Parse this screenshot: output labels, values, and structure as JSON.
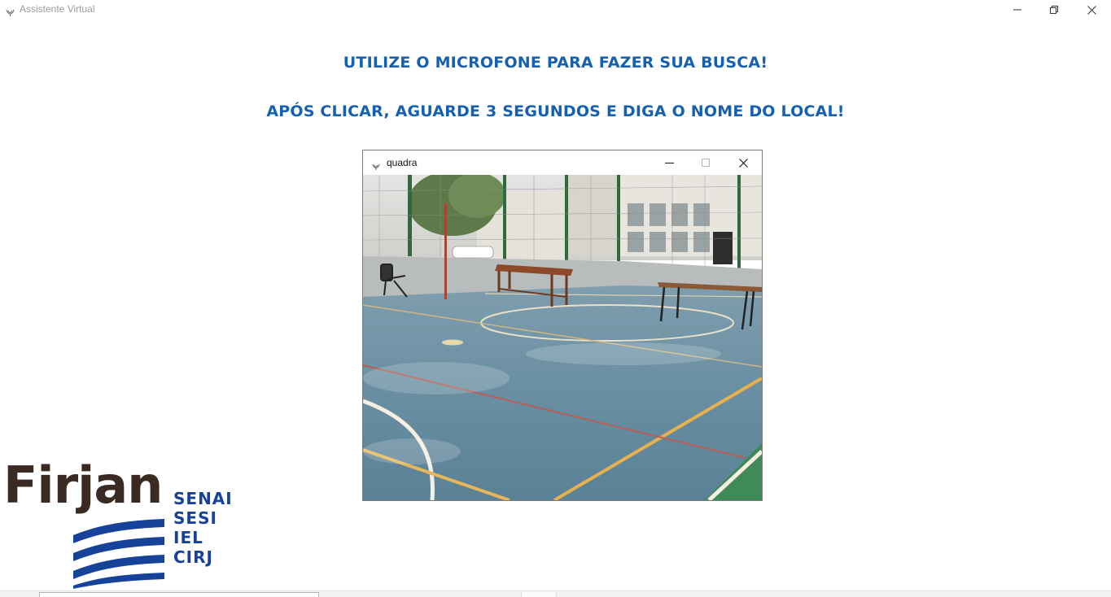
{
  "window": {
    "title": "Assistente Virtual",
    "icon": "horns-app-icon",
    "controls": [
      "minimize-icon",
      "restore-icon",
      "close-icon"
    ]
  },
  "headings": {
    "line1": "UTILIZE O MICROFONE PARA FAZER SUA BUSCA!",
    "line2": "APÓS CLICAR, AGUARDE 3 SEGUNDOS E DIGA O NOME DO LOCAL!"
  },
  "child_window": {
    "title": "quadra",
    "icon": "horns-app-icon",
    "controls": [
      "minimize-icon",
      "maximize-icon",
      "close-icon"
    ],
    "image": "photo of an indoor sports court with benches and a chair"
  },
  "logo": {
    "wordmark": "Firjan",
    "entities": [
      "SENAI",
      "SESI",
      "IEL",
      "CIRJ"
    ]
  },
  "colors": {
    "heading": "#1560b0",
    "logo_brown": "#3a2a22",
    "logo_blue": "#17429a",
    "court_floor": "#5f889c"
  }
}
